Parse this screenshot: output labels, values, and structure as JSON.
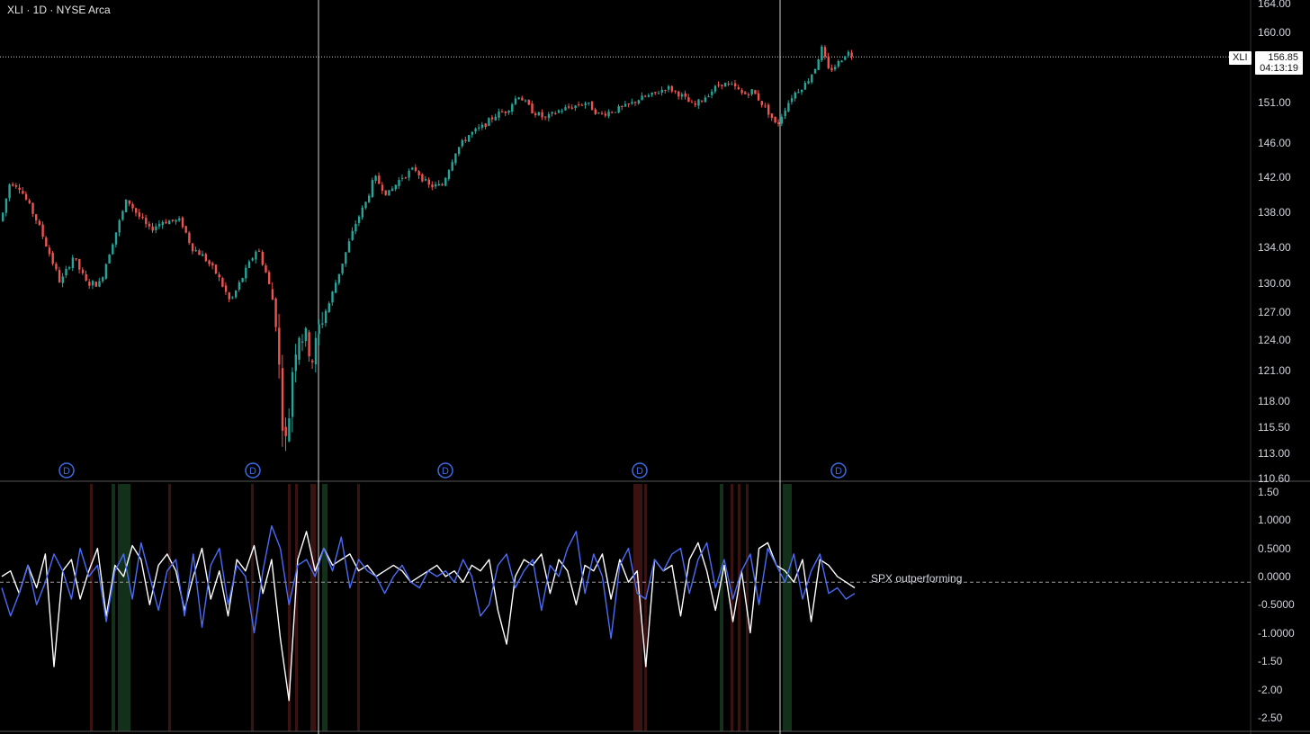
{
  "header": {
    "title": "XLI · 1D · NYSE Arca"
  },
  "price_tag": {
    "symbol": "XLI",
    "price": "156.85",
    "countdown": "04:13:19"
  },
  "colors": {
    "up": "#26a69a",
    "down": "#ef5350",
    "background": "#000000",
    "series_relative": "#ffffff",
    "series_spx": "#4a6cf7",
    "band_green": "#12301a",
    "band_red": "#3a1212",
    "dividend_marker": "#3d6be6"
  },
  "dividend_marker_label": "D",
  "chart_data": [
    {
      "type": "candlestick",
      "symbol": "XLI",
      "interval": "1D",
      "exchange": "NYSE Arca",
      "y_axis": {
        "ticks": [
          "164.00",
          "160.00",
          "151.00",
          "146.00",
          "142.00",
          "138.00",
          "134.00",
          "130.00",
          "127.00",
          "124.00",
          "121.00",
          "118.00",
          "115.50",
          "113.00",
          "110.60"
        ]
      },
      "last_price": 156.85,
      "price_path": [
        [
          0,
          137
        ],
        [
          10,
          141.5
        ],
        [
          20,
          141
        ],
        [
          40,
          137
        ],
        [
          55,
          133
        ],
        [
          66,
          130
        ],
        [
          80,
          133
        ],
        [
          95,
          130
        ],
        [
          110,
          130
        ],
        [
          122,
          134
        ],
        [
          140,
          139.5
        ],
        [
          150,
          138
        ],
        [
          165,
          136
        ],
        [
          180,
          137
        ],
        [
          200,
          137
        ],
        [
          212,
          134
        ],
        [
          225,
          133
        ],
        [
          240,
          131
        ],
        [
          255,
          128
        ],
        [
          270,
          131
        ],
        [
          285,
          134
        ],
        [
          295,
          131
        ],
        [
          305,
          127
        ],
        [
          312,
          117
        ],
        [
          318,
          113
        ],
        [
          322,
          120
        ],
        [
          330,
          125
        ],
        [
          340,
          124
        ],
        [
          347,
          122
        ],
        [
          355,
          126
        ],
        [
          365,
          128
        ],
        [
          375,
          131
        ],
        [
          385,
          134
        ],
        [
          395,
          137
        ],
        [
          405,
          139
        ],
        [
          415,
          142
        ],
        [
          430,
          140
        ],
        [
          445,
          142
        ],
        [
          460,
          143
        ],
        [
          475,
          141
        ],
        [
          490,
          141
        ],
        [
          505,
          145
        ],
        [
          520,
          147
        ],
        [
          535,
          148
        ],
        [
          550,
          149.5
        ],
        [
          562,
          150
        ],
        [
          575,
          152
        ],
        [
          590,
          150
        ],
        [
          605,
          149
        ],
        [
          620,
          150
        ],
        [
          635,
          150.5
        ],
        [
          650,
          151
        ],
        [
          665,
          149.5
        ],
        [
          680,
          150
        ],
        [
          695,
          150.5
        ],
        [
          710,
          151.5
        ],
        [
          725,
          152
        ],
        [
          740,
          153
        ],
        [
          755,
          152
        ],
        [
          770,
          150.5
        ],
        [
          785,
          152
        ],
        [
          800,
          153.5
        ],
        [
          815,
          153
        ],
        [
          825,
          152
        ],
        [
          835,
          152.5
        ],
        [
          845,
          151
        ],
        [
          855,
          149.5
        ],
        [
          862,
          148
        ],
        [
          870,
          150
        ],
        [
          880,
          152
        ],
        [
          895,
          153.5
        ],
        [
          905,
          155.5
        ],
        [
          912,
          158
        ],
        [
          920,
          155
        ],
        [
          930,
          156
        ],
        [
          940,
          157.5
        ],
        [
          950,
          156.85
        ]
      ],
      "dividend_markers_count": 5
    },
    {
      "type": "line",
      "y_axis": {
        "ticks": [
          "1.50",
          "1.0000",
          "0.5000",
          "0.0000",
          "-0.5000",
          "-1.0000",
          "-1.50",
          "-2.00",
          "-2.50"
        ],
        "ylim": [
          -2.6,
          1.6
        ]
      },
      "series": [
        {
          "values": [
            0.1,
            0.2,
            -0.2,
            0.3,
            -0.1,
            0.5,
            -1.5,
            0.2,
            0.4,
            -0.3,
            0.2,
            0.6,
            -0.6,
            0.3,
            0.1,
            0.65,
            0.4,
            -0.4,
            0.3,
            0.5,
            0.2,
            -0.5,
            0.1,
            0.6,
            -0.3,
            0.2,
            -0.6,
            0.4,
            0.2,
            0.65,
            -0.2,
            0.4,
            -1.0,
            -2.1,
            0.4,
            0.9,
            0.2,
            0.6,
            0.3,
            0.4,
            0.5,
            0.2,
            0.3,
            0.1,
            0.2,
            0.3,
            0.2,
            0.0,
            0.1,
            0.2,
            0.3,
            0.1,
            0.2,
            0.0,
            0.3,
            0.2,
            0.4,
            -0.5,
            -1.1,
            0.1,
            0.4,
            0.3,
            0.5,
            -0.2,
            0.4,
            0.2,
            -0.4,
            0.3,
            0.2,
            0.5,
            -0.3,
            0.4,
            0.0,
            0.2,
            -1.5,
            0.4,
            0.2,
            0.3,
            -0.6,
            0.4,
            0.7,
            0.2,
            -0.5,
            0.3,
            -0.7,
            0.2,
            -0.9,
            0.6,
            0.7,
            0.3,
            0.2,
            0.0,
            0.4,
            -0.7,
            0.4,
            0.3,
            0.1,
            0.0,
            -0.1
          ]
        },
        {
          "values": [
            -0.1,
            -0.6,
            -0.2,
            0.3,
            -0.4,
            0.0,
            0.5,
            0.2,
            -0.3,
            0.6,
            0.1,
            0.3,
            -0.7,
            0.2,
            0.5,
            -0.3,
            0.7,
            0.1,
            -0.5,
            0.2,
            0.4,
            -0.6,
            0.5,
            -0.8,
            0.3,
            0.6,
            -0.4,
            0.3,
            0.1,
            -0.9,
            0.2,
            1.0,
            0.6,
            -0.4,
            0.3,
            0.4,
            0.1,
            0.6,
            0.2,
            0.8,
            -0.1,
            0.4,
            0.2,
            0.1,
            -0.2,
            0.1,
            0.3,
            0.0,
            -0.1,
            0.2,
            0.1,
            0.2,
            0.0,
            0.4,
            0.1,
            -0.6,
            -0.4,
            0.3,
            0.5,
            -0.1,
            0.2,
            0.4,
            -0.5,
            0.3,
            0.1,
            0.6,
            0.9,
            -0.2,
            0.5,
            0.1,
            -1.0,
            0.3,
            0.6,
            -0.2,
            -0.3,
            0.4,
            0.2,
            0.5,
            0.6,
            -0.2,
            0.4,
            0.7,
            -0.1,
            0.4,
            -0.3,
            0.2,
            0.5,
            -0.4,
            0.6,
            0.3,
            0.0,
            0.5,
            -0.3,
            0.2,
            0.5,
            -0.2,
            -0.1,
            -0.3,
            -0.2
          ]
        }
      ],
      "reference_line": 0.0,
      "annotations": [
        {
          "text": "SPX outperforming"
        }
      ]
    }
  ]
}
